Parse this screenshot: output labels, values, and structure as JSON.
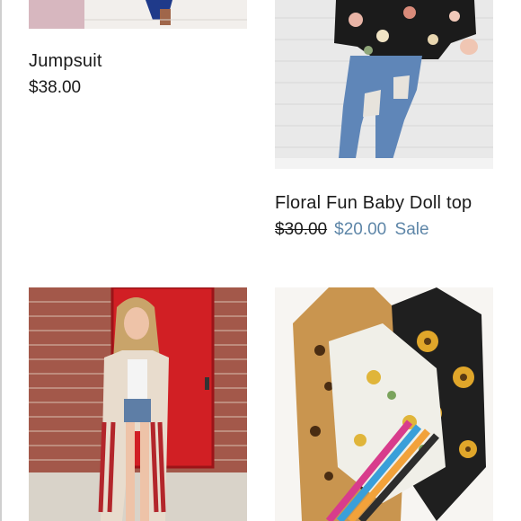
{
  "products": [
    {
      "title": "Jumpsuit",
      "price": "$38.00"
    },
    {
      "title": "Floral Fun Baby Doll top",
      "price_original": "$30.00",
      "price_sale": "$20.00",
      "sale_label": "Sale"
    },
    {
      "title": "",
      "image": "model-in-flag-kimono"
    },
    {
      "title": "",
      "image": "printed-bodysuits-flatlay"
    }
  ],
  "colors": {
    "sale": "#5e86a8",
    "text": "#1a1a1a"
  }
}
